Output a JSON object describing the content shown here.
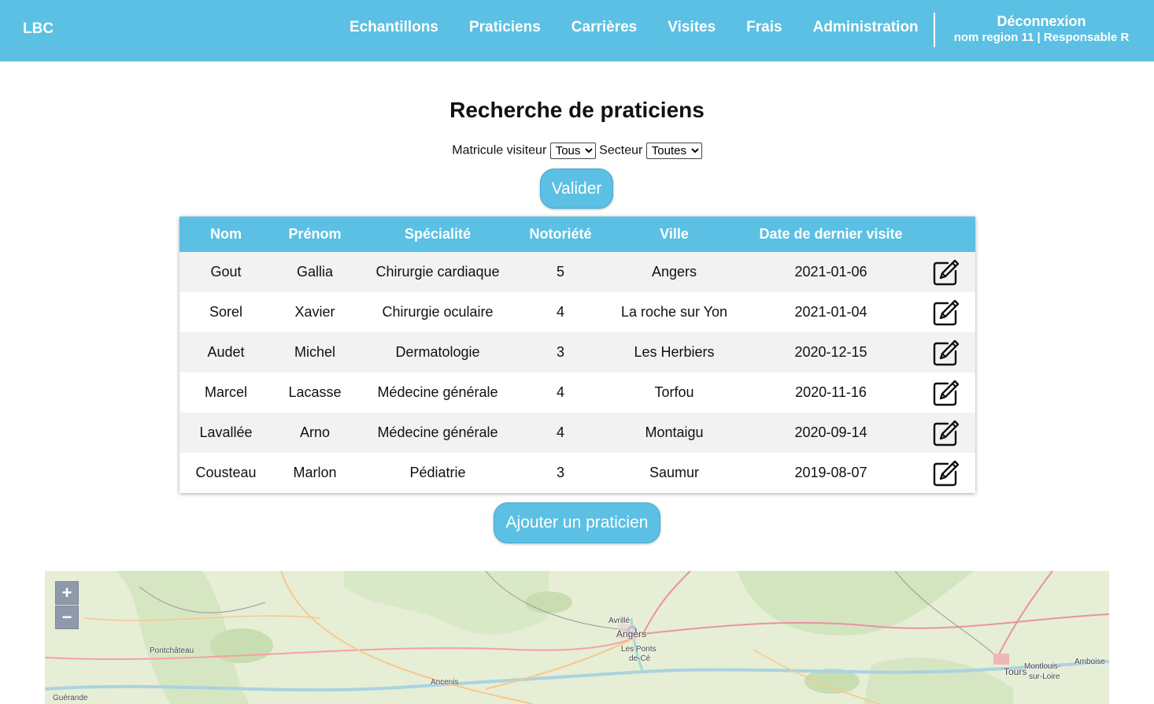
{
  "navbar": {
    "brand": "LBC",
    "links": [
      "Echantillons",
      "Praticiens",
      "Carrières",
      "Visites",
      "Frais",
      "Administration"
    ],
    "logout": "Déconnexion",
    "user_info": "nom region 11 | Responsable R"
  },
  "page": {
    "title": "Recherche de praticiens"
  },
  "filters": {
    "matricule_label": "Matricule visiteur",
    "matricule_value": "Tous",
    "secteur_label": "Secteur",
    "secteur_value": "Toutes",
    "submit_label": "Valider"
  },
  "table": {
    "headers": [
      "Nom",
      "Prénom",
      "Spécialité",
      "Notoriété",
      "Ville",
      "Date de dernier visite",
      ""
    ],
    "rows": [
      {
        "nom": "Gout",
        "prenom": "Gallia",
        "specialite": "Chirurgie cardiaque",
        "notoriete": "5",
        "ville": "Angers",
        "date": "2021-01-06"
      },
      {
        "nom": "Sorel",
        "prenom": "Xavier",
        "specialite": "Chirurgie oculaire",
        "notoriete": "4",
        "ville": "La roche sur Yon",
        "date": "2021-01-04"
      },
      {
        "nom": "Audet",
        "prenom": "Michel",
        "specialite": "Dermatologie",
        "notoriete": "3",
        "ville": "Les Herbiers",
        "date": "2020-12-15"
      },
      {
        "nom": "Marcel",
        "prenom": "Lacasse",
        "specialite": "Médecine générale",
        "notoriete": "4",
        "ville": "Torfou",
        "date": "2020-11-16"
      },
      {
        "nom": "Lavallée",
        "prenom": "Arno",
        "specialite": "Médecine générale",
        "notoriete": "4",
        "ville": "Montaigu",
        "date": "2020-09-14"
      },
      {
        "nom": "Cousteau",
        "prenom": "Marlon",
        "specialite": "Pédiatrie",
        "notoriete": "3",
        "ville": "Saumur",
        "date": "2019-08-07"
      }
    ],
    "edit_icon": "edit-icon"
  },
  "add_button": "Ajouter un praticien",
  "map": {
    "zoom_in": "+",
    "zoom_out": "−",
    "towns": [
      "Avrillé",
      "Angers",
      "Les Ponts",
      "de-Cé",
      "Pontchâteau",
      "Ancenis",
      "Guérande",
      "Tours",
      "Montlouis-",
      "sur-Loire",
      "Amboise"
    ]
  },
  "colors": {
    "accent": "#5bc0e3",
    "row_alt": "#f2f2f2"
  }
}
